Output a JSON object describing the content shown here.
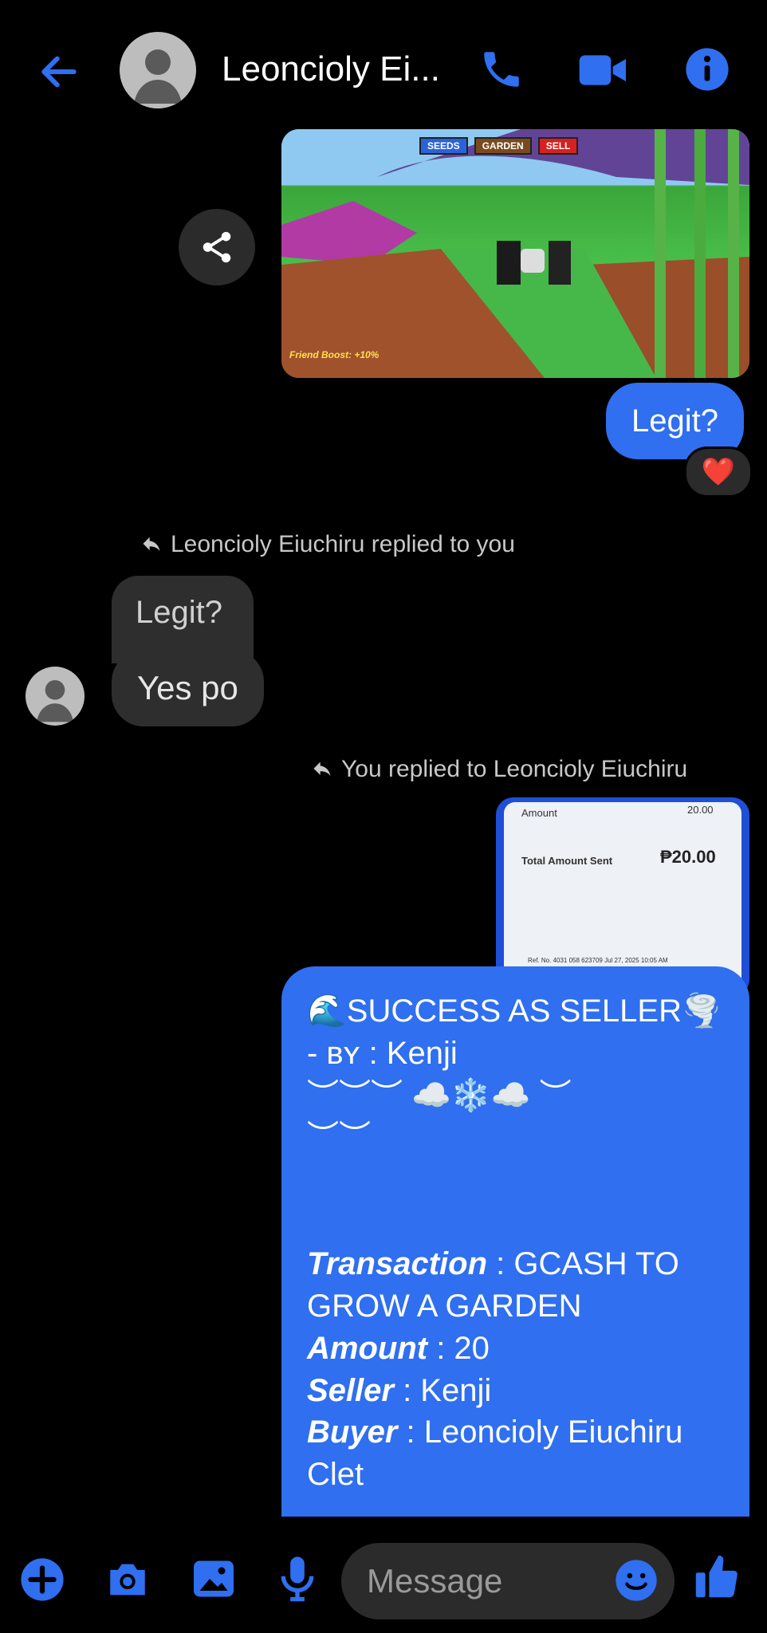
{
  "header": {
    "title": "Leoncioly Ei...",
    "back_icon": "arrow-left-icon",
    "call_icon": "phone-icon",
    "video_icon": "video-camera-icon",
    "info_icon": "info-icon",
    "accent": "#2f6ff0"
  },
  "messages": {
    "game_image": {
      "tabs": [
        "SEEDS",
        "GARDEN",
        "SELL"
      ],
      "caption": "Friend Boost: +10%"
    },
    "legit_out": "Legit?",
    "reaction": "❤️",
    "reply_note_in": "Leoncioly Eiuchiru replied to you",
    "quoted_text": "Legit?",
    "reply_in": "Yes po",
    "reply_note_out": "You replied to Leoncioly Eiuchiru",
    "receipt": {
      "amount_label": "Amount",
      "amount_top": "20.00",
      "total_label": "Total Amount Sent",
      "total_value": "₱20.00",
      "ref": "Ref. No. 4031 058 623709 Jul 27, 2025 10:05 AM"
    },
    "card": {
      "headline": "🌊SUCCESS AS SELLER🌪️",
      "by_line": "- ʙʏ : Kenji",
      "deco_line1": "︶︶︶ ☁️❄️☁️ ︶",
      "deco_line2": "︶︶",
      "transaction_label": "Transaction",
      "transaction_value": " : GCASH TO GROW A GARDEN",
      "amount_label": "Amount",
      "amount_value": " : 20",
      "seller_label": "Seller",
      "seller_value": " : Kenji",
      "buyer_label": "Buyer",
      "buyer_value": " : Leoncioly Eiuchiru Clet"
    }
  },
  "composer": {
    "placeholder": "Message",
    "plus_icon": "plus-circle-icon",
    "camera_icon": "camera-icon",
    "gallery_icon": "image-icon",
    "mic_icon": "microphone-icon",
    "emoji_icon": "emoji-icon",
    "like_icon": "thumbs-up-icon"
  }
}
